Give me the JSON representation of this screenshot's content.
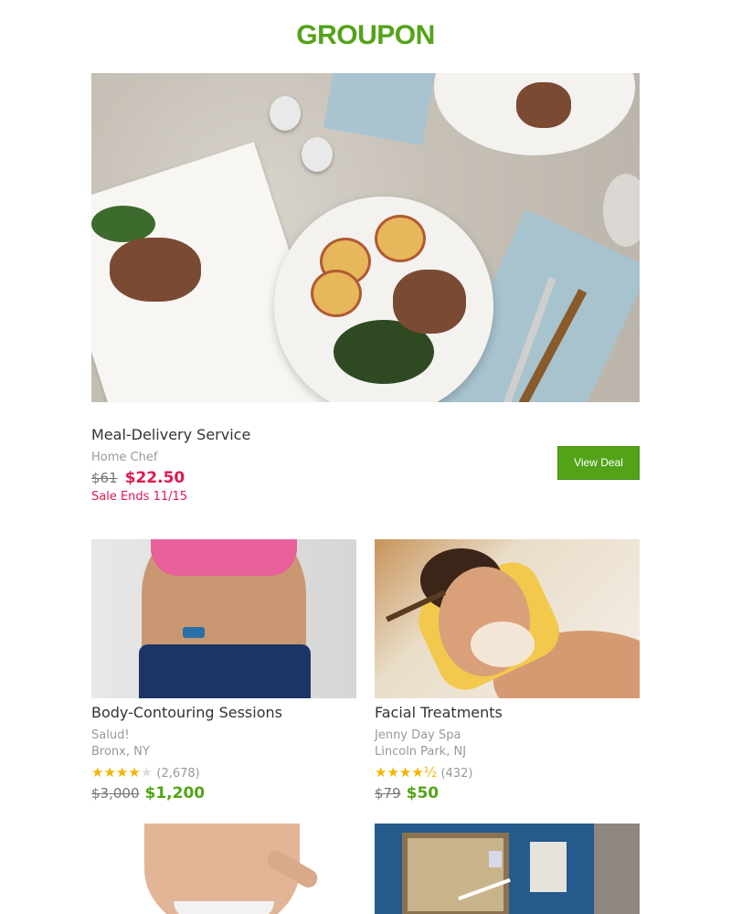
{
  "brand": {
    "logo_text": "GROUPON",
    "accent_color": "#53a318"
  },
  "featured": {
    "title": "Meal-Delivery Service",
    "merchant": "Home Chef",
    "old_price": "$61",
    "new_price": "$22.50",
    "sale_ends": "Sale Ends 11/15",
    "button_label": "View Deal",
    "image_icon": "meal-delivery-photo"
  },
  "deals": [
    {
      "title": "Body-Contouring Sessions",
      "merchant": "Salud!",
      "location": "Bronx, NY",
      "rating": 4,
      "rating_stars": "★★★★",
      "rating_empty": "★",
      "review_count": "(2,678)",
      "old_price": "$3,000",
      "new_price": "$1,200"
    },
    {
      "title": "Facial Treatments",
      "merchant": "Jenny Day Spa",
      "location": "Lincoln Park, NJ",
      "rating": 4.5,
      "rating_stars": "★★★★½",
      "review_count": "(432)",
      "old_price": "$79",
      "new_price": "$50"
    }
  ],
  "colors": {
    "sale_red": "#e0184e",
    "price_green": "#53a318"
  }
}
